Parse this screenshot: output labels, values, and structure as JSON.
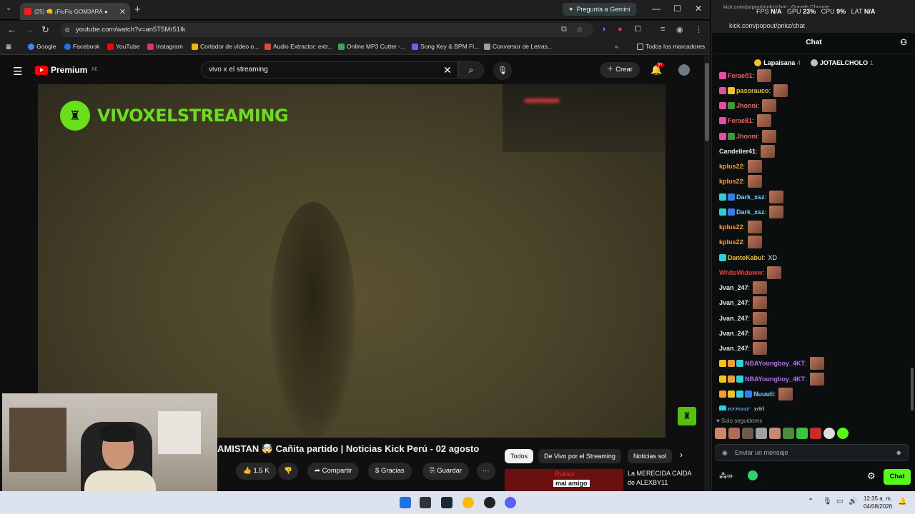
{
  "browser": {
    "tab_title": "(25) 👊 ¡FiuFiu GOM3ARÁ ●",
    "gemini_label": "Pregunta a Gemini",
    "url": "youtube.com/watch?v=an5T5Mr51Ik",
    "bookmarks": [
      {
        "label": "Google",
        "color": "#4285f4"
      },
      {
        "label": "Facebook",
        "color": "#1877f2"
      },
      {
        "label": "YouTube",
        "color": "#ff0000"
      },
      {
        "label": "Instagram",
        "color": "#e1306c"
      },
      {
        "label": "Cortador de vídeo o...",
        "color": "#f4b400"
      },
      {
        "label": "Audio Extractor: extr...",
        "color": "#ea4335"
      },
      {
        "label": "Online MP3 Cutter -...",
        "color": "#34a853"
      },
      {
        "label": "Song Key & BPM Fi...",
        "color": "#7a5af8"
      },
      {
        "label": "Conversor de Letras...",
        "color": "#9aa0a6"
      }
    ],
    "all_bookmarks": "Todos los marcadores"
  },
  "youtube": {
    "brand": "Premium",
    "region": "PE",
    "search_query": "vivo x el streaming",
    "create_label": "Crear",
    "notif_count": "9+",
    "video_overlay": "VIVOXELSTREAMING",
    "video_title": "AMISTAN 🤯 Cañita partido | Noticias Kick Perú - 02 agosto",
    "likes": "1.5 K",
    "share": "Compartir",
    "thanks": "Gracias",
    "save": "Guardar",
    "more": "···",
    "chips": [
      "Todos",
      "De Vivo por el Streaming",
      "Noticias sol"
    ],
    "rec_caption": "mal amigo",
    "rec_overlay_name": "Rubius",
    "rec_title": "La MERECIDA CAÍDA de ALEXBY11"
  },
  "chat": {
    "window_title": "kick.com/popout/pnkz/chat - Google Chrome",
    "perf": {
      "fps_label": "FPS",
      "fps": "N/A",
      "gpu_label": "GPU",
      "gpu": "23%",
      "cpu_label": "CPU",
      "cpu": "9%",
      "lat_label": "LAT",
      "lat": "N/A"
    },
    "url": "kick.com/popout/pnkz/chat",
    "header": "Chat",
    "pinned": [
      {
        "name": "Lapaisana",
        "count": "4",
        "color": "#f0c419"
      },
      {
        "name": "JOTAELCHOLO",
        "count": "1",
        "color": "#c0c0c0"
      }
    ],
    "messages": [
      {
        "user": "Feraeб1",
        "color": "#ff5a5a",
        "text": "",
        "emote": true,
        "badges": [
          "#e34fa1"
        ]
      },
      {
        "user": "pasorauco",
        "color": "#f0c419",
        "text": "",
        "emote": true,
        "badges": [
          "#e34fa1",
          "#f0c419"
        ]
      },
      {
        "user": "Jhonni",
        "color": "#ff5a5a",
        "text": "",
        "emote": true,
        "badges": [
          "#e34fa1",
          "#3b9b2f"
        ]
      },
      {
        "user": "Ferae81",
        "color": "#ff5a5a",
        "text": "",
        "emote": true,
        "badges": [
          "#e34fa1"
        ]
      },
      {
        "user": "Jhonni",
        "color": "#ff5a5a",
        "text": "",
        "emote": true,
        "badges": [
          "#e34fa1",
          "#3b9b2f"
        ]
      },
      {
        "user": "Candelier41",
        "color": "#e8e8e8",
        "text": "",
        "emote": true,
        "badges": []
      },
      {
        "user": "kplus22",
        "color": "#f0a030",
        "text": "",
        "emote": true,
        "badges": []
      },
      {
        "user": "kplus22",
        "color": "#f0a030",
        "text": "",
        "emote": true,
        "badges": []
      },
      {
        "user": "Dark_xsz",
        "color": "#6fd3ff",
        "text": "",
        "emote": true,
        "badges": [
          "#2ecfd8",
          "#2f7df0"
        ]
      },
      {
        "user": "Dark_xsz",
        "color": "#6fd3ff",
        "text": "",
        "emote": true,
        "badges": [
          "#2ecfd8",
          "#2f7df0"
        ]
      },
      {
        "user": "kplus22",
        "color": "#f0a030",
        "text": "",
        "emote": true,
        "badges": []
      },
      {
        "user": "kplus22",
        "color": "#f0a030",
        "text": "",
        "emote": true,
        "badges": []
      },
      {
        "user": "DanteKabul",
        "color": "#f0c419",
        "text": "XD",
        "emote": false,
        "badges": [
          "#2ecfd8"
        ]
      },
      {
        "user": "WhiteWidoww",
        "color": "#e0403a",
        "text": "",
        "emote": true,
        "badges": []
      },
      {
        "user": "Jvan_247",
        "color": "#e8e8e8",
        "text": "",
        "emote": true,
        "badges": []
      },
      {
        "user": "Jvan_247",
        "color": "#e8e8e8",
        "text": "",
        "emote": true,
        "badges": []
      },
      {
        "user": "Jvan_247",
        "color": "#e8e8e8",
        "text": "",
        "emote": true,
        "badges": []
      },
      {
        "user": "Jvan_247",
        "color": "#e8e8e8",
        "text": "",
        "emote": true,
        "badges": []
      },
      {
        "user": "Jvan_247",
        "color": "#e8e8e8",
        "text": "",
        "emote": true,
        "badges": []
      },
      {
        "user": "NBAYoungboy_4KT",
        "color": "#b56ef0",
        "text": "",
        "emote": true,
        "badges": [
          "#f0c419",
          "#f0a030",
          "#2ecfd8"
        ]
      },
      {
        "user": "NBAYoungboy_4KT",
        "color": "#b56ef0",
        "text": "",
        "emote": true,
        "badges": [
          "#f0c419",
          "#f0a030",
          "#2ecfd8"
        ]
      },
      {
        "user": "Nuuuti",
        "color": "#6fd3ff",
        "text": "",
        "emote": true,
        "badges": [
          "#f0a030",
          "#f0c419",
          "#2ecfd8",
          "#2f7df0"
        ]
      },
      {
        "user": "gzzuuz",
        "color": "#6fa8ff",
        "text": "xdd",
        "emote": false,
        "badges": [
          "#2ecfd8"
        ]
      }
    ],
    "followers_only": "Solo seguidores",
    "input_placeholder": "Enviar un mensaje",
    "send_label": "Chat"
  },
  "taskbar": {
    "time": "12:35 a. m.",
    "date": "04/08/2026"
  }
}
